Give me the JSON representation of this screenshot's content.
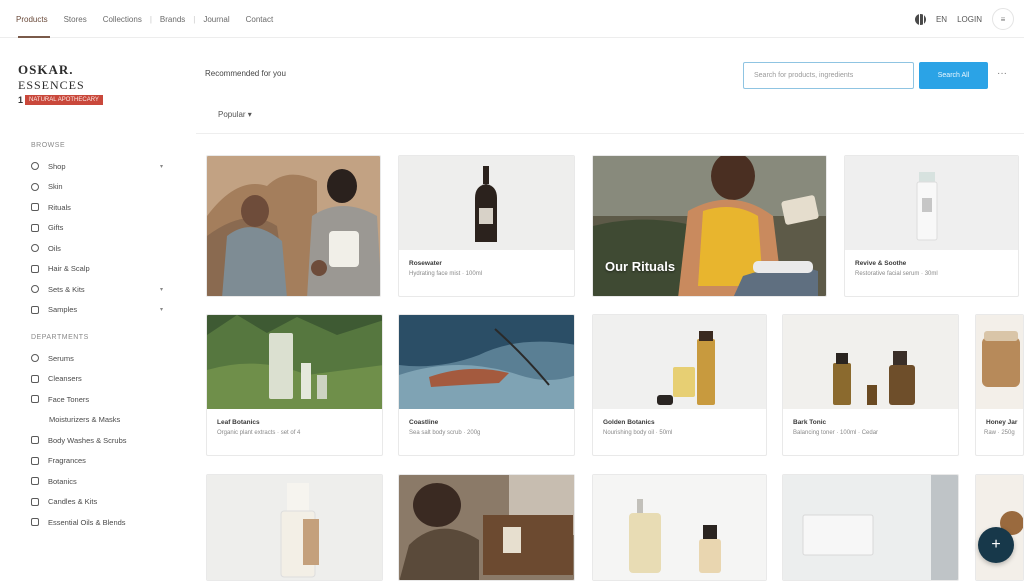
{
  "nav": {
    "tabs": [
      {
        "label": "Products"
      },
      {
        "label": "Stores"
      },
      {
        "label": "Collections"
      },
      {
        "label": "Brands"
      },
      {
        "label": "Journal"
      },
      {
        "label": "Contact"
      }
    ],
    "right": {
      "lang": "EN",
      "account": "LOGIN"
    }
  },
  "brand": {
    "line1": "OSKAR.",
    "line2": "ESSENCES",
    "line3_prefix": "1",
    "tag": "NATURAL APOTHECARY"
  },
  "sidebar": {
    "section1": "BROWSE",
    "items1": [
      "Shop",
      "Skin",
      "Rituals",
      "Gifts",
      "Oils",
      "Hair & Scalp",
      "Sets & Kits",
      "Samples"
    ],
    "section2": "DEPARTMENTS",
    "items2": [
      "Serums",
      "Cleansers",
      "Face Toners",
      "Moisturizers & Masks",
      "Body Washes & Scrubs",
      "Fragrances",
      "Botanics",
      "Candles & Kits",
      "Essential Oils & Blends"
    ]
  },
  "main": {
    "breadcrumb": "Recommended for you",
    "search_placeholder": "Search for products, ingredients",
    "search_button": "Search All",
    "filter": "Popular ▾"
  },
  "cards": [
    {
      "caption": "",
      "sub": ""
    },
    {
      "caption": "Rosewater",
      "sub": "Hydrating face mist · 100ml"
    },
    {
      "caption": "",
      "sub": "",
      "overlay": "Our Rituals"
    },
    {
      "caption": "Revive & Soothe",
      "sub": "Restorative facial serum · 30ml"
    },
    {
      "caption": "Leaf Botanics",
      "sub": "Organic plant extracts · set of 4"
    },
    {
      "caption": "Coastline",
      "sub": "Sea salt body scrub · 200g"
    },
    {
      "caption": "Golden Botanics",
      "sub": "Nourishing body oil · 50ml"
    },
    {
      "caption": "Bark Tonic",
      "sub": "Balancing toner · 100ml · Cedar"
    },
    {
      "caption": "Honey Jar",
      "sub": "Raw · 250g"
    },
    {
      "caption": "",
      "sub": ""
    },
    {
      "caption": "",
      "sub": ""
    },
    {
      "caption": "",
      "sub": ""
    },
    {
      "caption": "",
      "sub": ""
    },
    {
      "caption": "",
      "sub": ""
    }
  ]
}
